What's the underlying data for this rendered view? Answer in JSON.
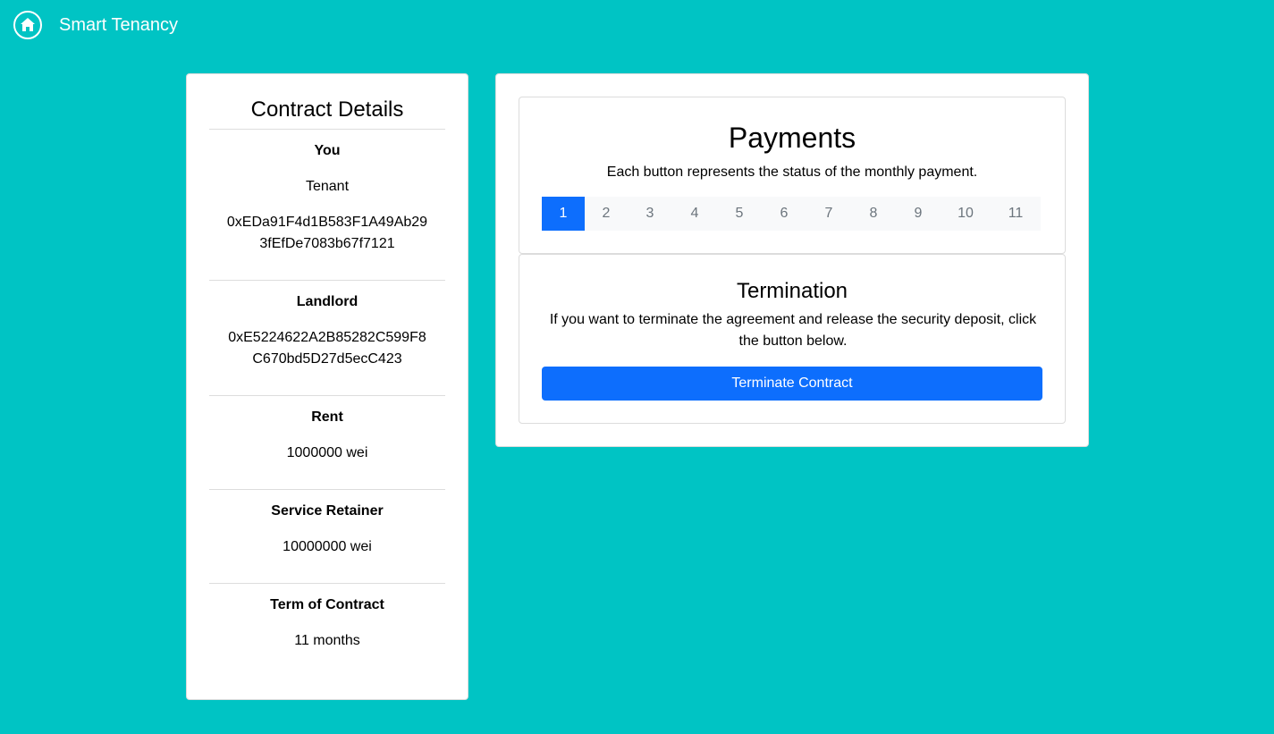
{
  "nav": {
    "brand": "Smart Tenancy",
    "home_icon": "home-icon"
  },
  "details": {
    "title": "Contract Details",
    "you_label": "You",
    "you_role": "Tenant",
    "you_address": "0xEDa91F4d1B583F1A49Ab293fEfDe7083b67f7121",
    "landlord_label": "Landlord",
    "landlord_address": "0xE5224622A2B85282C599F8C670bd5D27d5ecC423",
    "rent_label": "Rent",
    "rent_value": "1000000 wei",
    "retainer_label": "Service Retainer",
    "retainer_value": "10000000 wei",
    "term_label": "Term of Contract",
    "term_value": "11 months"
  },
  "payments": {
    "title": "Payments",
    "description": "Each button represents the status of the monthly payment.",
    "months": [
      "1",
      "2",
      "3",
      "4",
      "5",
      "6",
      "7",
      "8",
      "9",
      "10",
      "11"
    ],
    "active_month": "1"
  },
  "termination": {
    "title": "Termination",
    "description": "If you want to terminate the agreement and release the security deposit, click the button below.",
    "button_label": "Terminate Contract"
  },
  "colors": {
    "background": "#00c4c4",
    "primary": "#0d6efd"
  }
}
